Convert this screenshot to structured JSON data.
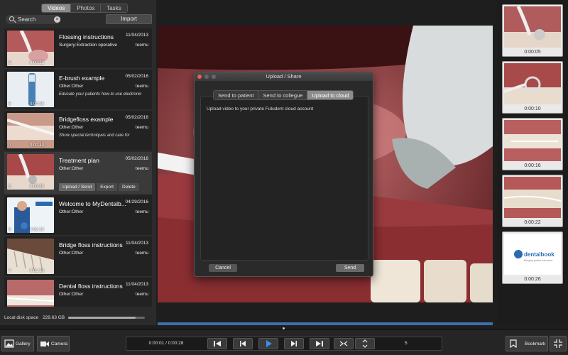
{
  "colors": {
    "accent": "#3d6fae",
    "play_icon": "#3a8ee8",
    "background": "#1e1e1e"
  },
  "tabs": [
    {
      "label": "Videos",
      "active": true
    },
    {
      "label": "Photos",
      "active": false
    },
    {
      "label": "Tasks",
      "active": false
    }
  ],
  "search": {
    "placeholder": "Search"
  },
  "import_label": "Import",
  "videos": [
    {
      "num": "6",
      "duration": "0:00:22",
      "title": "Flossing instructions",
      "date": "11/04/2013",
      "category": "Surgery:Extraction operative",
      "user": "teemu",
      "description": ""
    },
    {
      "num": "6",
      "duration": "0:00:36",
      "title": "E-brush example",
      "date": "05/02/2016",
      "category": "Other:Other",
      "user": "teemu",
      "description": "Educate your patients how-to use electronic"
    },
    {
      "num": "0",
      "duration": "0:00:40",
      "title": "Bridgefloss example",
      "date": "05/02/2016",
      "category": "Other:Other",
      "user": "teemu",
      "description": "Show special techniques and care for"
    },
    {
      "num": "5",
      "duration": "0:00:28",
      "title": "Treatment plan",
      "date": "05/02/2016",
      "category": "Other:Other",
      "user": "teemu",
      "description": "",
      "selected": true
    },
    {
      "num": "0",
      "duration": "0:02:10",
      "title": "Welcome to MyDentalb...",
      "date": "04/29/2016",
      "category": "Other:Other",
      "user": "teemu",
      "description": ""
    },
    {
      "num": "7",
      "duration": "0:01:39",
      "title": "Bridge floss instructions",
      "date": "11/04/2013",
      "category": "Other:Other",
      "user": "teemu",
      "description": ""
    },
    {
      "num": "",
      "duration": "",
      "title": "Dental floss instructions",
      "date": "11/04/2013",
      "category": "Other:Other",
      "user": "teemu",
      "description": ""
    }
  ],
  "item_actions": {
    "upload": "Upload / Send",
    "export": "Export",
    "delete": "Delete"
  },
  "disk": {
    "label": "Local disk space",
    "value": "229.63 GB",
    "used_fraction": 0.88
  },
  "snapshots": [
    "0:00:05",
    "0:00:10",
    "0:00:16",
    "0:00:22",
    "0:00:26"
  ],
  "snapshot_logo": {
    "brand": "dentalbook",
    "tagline": "Bringing patient education"
  },
  "dialog": {
    "title": "Upload / Share",
    "tabs": [
      "Send to patient",
      "Send to collegue",
      "Upload to cloud"
    ],
    "active_tab": 2,
    "message": "Upload video to your private Futudent cloud account",
    "cancel": "Cancel",
    "send": "Send"
  },
  "bottom": {
    "gallery": "Gallery",
    "camera": "Camera",
    "timecode": "0:00:01 / 0:00:28",
    "speed": "5",
    "bookmark": "Bookmark"
  },
  "icons": [
    "gallery-icon",
    "camera-icon",
    "prev-frame-icon",
    "step-back-icon",
    "play-icon",
    "step-forward-icon",
    "next-frame-icon",
    "collapse-icon",
    "updown-icon",
    "bookmark-icon",
    "fullscreen-icon"
  ]
}
